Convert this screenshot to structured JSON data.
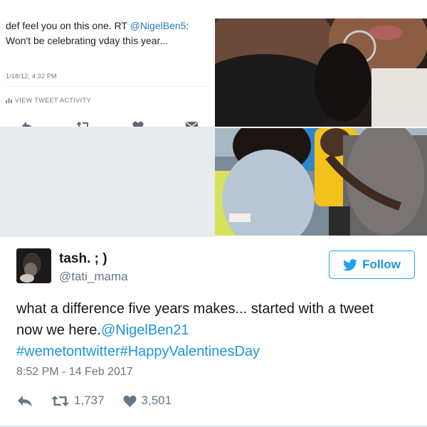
{
  "old_tweet": {
    "text_prefix": "def feel you on this one. RT ",
    "mention": "@NigelBen5",
    "text_suffix": ":",
    "text_line2": "Won't be celebrating vday this year...",
    "timestamp": "1/18/12, 4:32 PM",
    "activity_label": "VIEW TWEET ACTIVITY",
    "actions": [
      "reply-icon",
      "retweet-icon",
      "heart-icon",
      "message-icon"
    ]
  },
  "tweet": {
    "display_name": "tash. ; )",
    "handle": "@tati_mama",
    "follow_label": "Follow",
    "text_line1": "what a difference five years makes... started with a tweet",
    "text_line2_plain": "now we here.",
    "text_line2_mention": "@NigelBen21",
    "hashtags": "#wemetontwitter#HappyValentinesDay",
    "timestamp": "8:52 PM - 14 Feb 2017",
    "retweets": "1,737",
    "likes": "3,501"
  },
  "colors": {
    "accent": "#1da1f2",
    "link": "#1b95e0",
    "muted": "#657786"
  }
}
